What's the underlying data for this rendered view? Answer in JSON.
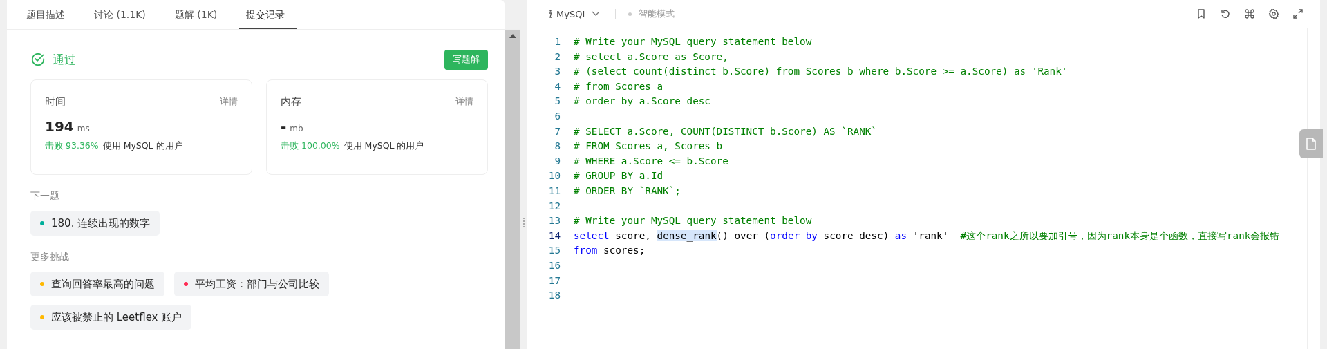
{
  "tabs": [
    {
      "label": "题目描述",
      "selected": false
    },
    {
      "label": "讨论 (1.1K)",
      "selected": false
    },
    {
      "label": "题解 (1K)",
      "selected": false
    },
    {
      "label": "提交记录",
      "selected": true
    }
  ],
  "result": {
    "status": "通过",
    "button": "写题解"
  },
  "stats": [
    {
      "title": "时间",
      "detail": "详情",
      "value": "194",
      "unit": "ms",
      "beat": "击败",
      "percent": "93.36%",
      "rest": "使用 MySQL 的用户"
    },
    {
      "title": "内存",
      "detail": "详情",
      "value": "-",
      "unit": "mb",
      "beat": "击败",
      "percent": "100.00%",
      "rest": "使用 MySQL 的用户"
    }
  ],
  "next": {
    "heading": "下一题",
    "items": [
      {
        "label": "180. 连续出现的数字",
        "color": "#00af9b"
      }
    ]
  },
  "more": {
    "heading": "更多挑战",
    "items": [
      {
        "label": "查询回答率最高的问题",
        "color": "#ffb800"
      },
      {
        "label": "平均工资：部门与公司比较",
        "color": "#ff2d55"
      },
      {
        "label": "应该被禁止的 Leetflex 账户",
        "color": "#ffb800"
      }
    ]
  },
  "editor": {
    "language": "MySQL",
    "mode": "智能模式",
    "lines": [
      {
        "number": "1",
        "current": false,
        "tokens": [
          {
            "kind": "comment",
            "text": "# Write your MySQL query statement below"
          }
        ]
      },
      {
        "number": "2",
        "current": false,
        "tokens": [
          {
            "kind": "comment",
            "text": "# select a.Score as Score,"
          }
        ]
      },
      {
        "number": "3",
        "current": false,
        "tokens": [
          {
            "kind": "comment",
            "text": "# (select count(distinct b.Score) from Scores b where b.Score >= a.Score) as 'Rank'"
          }
        ]
      },
      {
        "number": "4",
        "current": false,
        "tokens": [
          {
            "kind": "comment",
            "text": "# from Scores a"
          }
        ]
      },
      {
        "number": "5",
        "current": false,
        "tokens": [
          {
            "kind": "comment",
            "text": "# order by a.Score desc"
          }
        ]
      },
      {
        "number": "6",
        "current": false
      },
      {
        "number": "7",
        "current": false,
        "tokens": [
          {
            "kind": "comment",
            "text": "# SELECT a.Score, COUNT(DISTINCT b.Score) AS `RANK`"
          }
        ]
      },
      {
        "number": "8",
        "current": false,
        "tokens": [
          {
            "kind": "comment",
            "text": "# FROM Scores a, Scores b"
          }
        ]
      },
      {
        "number": "9",
        "current": false,
        "tokens": [
          {
            "kind": "comment",
            "text": "# WHERE a.Score <= b.Score"
          }
        ]
      },
      {
        "number": "10",
        "current": false,
        "tokens": [
          {
            "kind": "comment",
            "text": "# GROUP BY a.Id"
          }
        ]
      },
      {
        "number": "11",
        "current": false,
        "tokens": [
          {
            "kind": "comment",
            "text": "# ORDER BY `RANK`;"
          }
        ]
      },
      {
        "number": "12",
        "current": false
      },
      {
        "number": "13",
        "current": false,
        "tokens": [
          {
            "kind": "comment",
            "text": "# Write your MySQL query statement below"
          }
        ]
      },
      {
        "number": "14",
        "current": true,
        "tokens": [
          {
            "kind": "keyword",
            "text": "select"
          },
          {
            "kind": "plain",
            "text": " score, "
          },
          {
            "kind": "highlight",
            "text": "dense_rank"
          },
          {
            "kind": "plain",
            "text": "() over ("
          },
          {
            "kind": "keyword",
            "text": "order by"
          },
          {
            "kind": "plain",
            "text": " score desc) "
          },
          {
            "kind": "keyword",
            "text": "as"
          },
          {
            "kind": "plain",
            "text": " 'rank'  "
          },
          {
            "kind": "comment",
            "text": "#这个rank之所以要加引号，因为rank本身是个函数，直接写rank会报错"
          }
        ]
      },
      {
        "number": "15",
        "current": false,
        "tokens": [
          {
            "kind": "keyword",
            "text": "from"
          },
          {
            "kind": "plain",
            "text": " scores;"
          }
        ]
      },
      {
        "number": "16",
        "current": false
      },
      {
        "number": "17",
        "current": false
      },
      {
        "number": "18",
        "current": false
      }
    ]
  }
}
